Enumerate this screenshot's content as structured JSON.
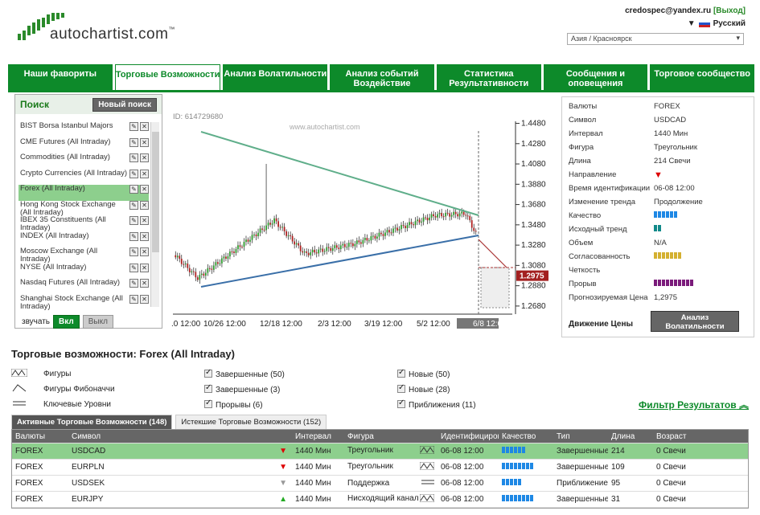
{
  "header": {
    "brand": "autochartist.com",
    "trademark": "™",
    "user_email": "credospec@yandex.ru",
    "logout": "[Выход]",
    "language": "Русский",
    "timezone": "Азия / Красноярск"
  },
  "tabs": [
    {
      "label": "Наши фавориты"
    },
    {
      "label": "Торговые Возможности"
    },
    {
      "label": "Анализ Волатильности"
    },
    {
      "label": "Анализ событий Воздействие"
    },
    {
      "label": "Статистика Результативности"
    },
    {
      "label": "Сообщения и оповещения"
    },
    {
      "label": "Торговое сообщество"
    }
  ],
  "search": {
    "title": "Поиск",
    "new_search": "Новый поиск",
    "items": [
      {
        "label": "BIST Borsa Istanbul Majors"
      },
      {
        "label": "CME Futures (All Intraday)"
      },
      {
        "label": "Commodities (All Intraday)"
      },
      {
        "label": "Crypto Currencies (All Intraday)"
      },
      {
        "label": "Forex (All Intraday)"
      },
      {
        "label": "Hong Kong Stock Exchange (All Intraday)"
      },
      {
        "label": "IBEX 35 Constituents (All Intraday)"
      },
      {
        "label": "INDEX (All Intraday)"
      },
      {
        "label": "Moscow Exchange (All Intraday)"
      },
      {
        "label": "NYSE (All Intraday)"
      },
      {
        "label": "Nasdaq Futures (All Intraday)"
      },
      {
        "label": "Shanghai Stock Exchange (All Intraday)"
      }
    ],
    "sound_label": "звучать",
    "sound_on": "Вкл",
    "sound_off": "Выкл"
  },
  "chart_data": {
    "type": "candlestick",
    "id_label": "ID: 614729680",
    "watermark": "www.autochartist.com",
    "x_ticks": [
      ".0 12:00",
      "10/26 12:00",
      "12/18 12:00",
      "2/3 12:00",
      "3/19 12:00",
      "5/2 12:00",
      "6/8 12:00"
    ],
    "y_ticks": [
      "1.4480",
      "1.4280",
      "1.4080",
      "1.3880",
      "1.3680",
      "1.3480",
      "1.3280",
      "1.3080",
      "1.2880",
      "1.2680"
    ],
    "forecast_price": "1.2975",
    "ylim": [
      1.26,
      1.45
    ]
  },
  "info": {
    "rows": [
      {
        "k": "Валюты",
        "v": "FOREX"
      },
      {
        "k": "Символ",
        "v": "USDCAD"
      },
      {
        "k": "Интервал",
        "v": "1440 Мин"
      },
      {
        "k": "Фигура",
        "v": "Треугольник"
      },
      {
        "k": "Длина",
        "v": "214 Свечи"
      },
      {
        "k": "Направление",
        "v": ""
      },
      {
        "k": "Время идентификации",
        "v": "06-08 12:00"
      },
      {
        "k": "Изменение тренда",
        "v": "Продолжение"
      },
      {
        "k": "Качество",
        "v": ""
      },
      {
        "k": "Исходный тренд",
        "v": ""
      },
      {
        "k": "Объем",
        "v": "N/A"
      },
      {
        "k": "Согласованность",
        "v": ""
      },
      {
        "k": "Четкость",
        "v": ""
      },
      {
        "k": "Прорыв",
        "v": ""
      },
      {
        "k": "Прогнозируемая Цена",
        "v": "1,2975"
      }
    ],
    "price_movement": "Движение Цены",
    "volatility_btn": "Анализ Волатильности"
  },
  "opportunities": {
    "title": "Торговые возможности: Forex (All Intraday)",
    "legend": [
      "Фигуры",
      "Фигуры Фибоначчи",
      "Ключевые Уровни"
    ],
    "filters_col1": [
      "Завершенные (50)",
      "Завершенные (3)",
      "Прорывы (6)"
    ],
    "filters_col2": [
      "Новые (50)",
      "Новые (28)",
      "Приближения (11)"
    ],
    "filter_link": "Фильтр Результатов",
    "subtabs": [
      "Активные Торговые Возможности (148)",
      "Истекшие Торговые Возможности (152)"
    ],
    "columns": [
      "Валюты",
      "Символ",
      "Интервал",
      "Фигура",
      "Идентифициров",
      "Качество",
      "Тип",
      "Длина",
      "Возраст"
    ],
    "rows": [
      {
        "cur": "FOREX",
        "sym": "USDCAD",
        "int": "1440 Мин",
        "fig": "Треугольник",
        "time": "06-08 12:00",
        "type": "Завершенные",
        "len": "214",
        "age": "0 Свечи"
      },
      {
        "cur": "FOREX",
        "sym": "EURPLN",
        "int": "1440 Мин",
        "fig": "Треугольник",
        "time": "06-08 12:00",
        "type": "Завершенные",
        "len": "109",
        "age": "0 Свечи"
      },
      {
        "cur": "FOREX",
        "sym": "USDSEK",
        "int": "1440 Мин",
        "fig": "Поддержка",
        "time": "06-08 12:00",
        "type": "Приближение",
        "len": "95",
        "age": "0 Свечи"
      },
      {
        "cur": "FOREX",
        "sym": "EURJPY",
        "int": "1440 Мин",
        "fig": "Нисходящий канал",
        "time": "06-08 12:00",
        "type": "Завершенные",
        "len": "31",
        "age": "0 Свечи"
      }
    ]
  },
  "colors": {
    "brand_green": "#0d8a2a",
    "selected_row": "#8dcf8d",
    "quality_blue": "#1e88e5",
    "gold": "#d4b030",
    "purple": "#7a1a7a"
  }
}
